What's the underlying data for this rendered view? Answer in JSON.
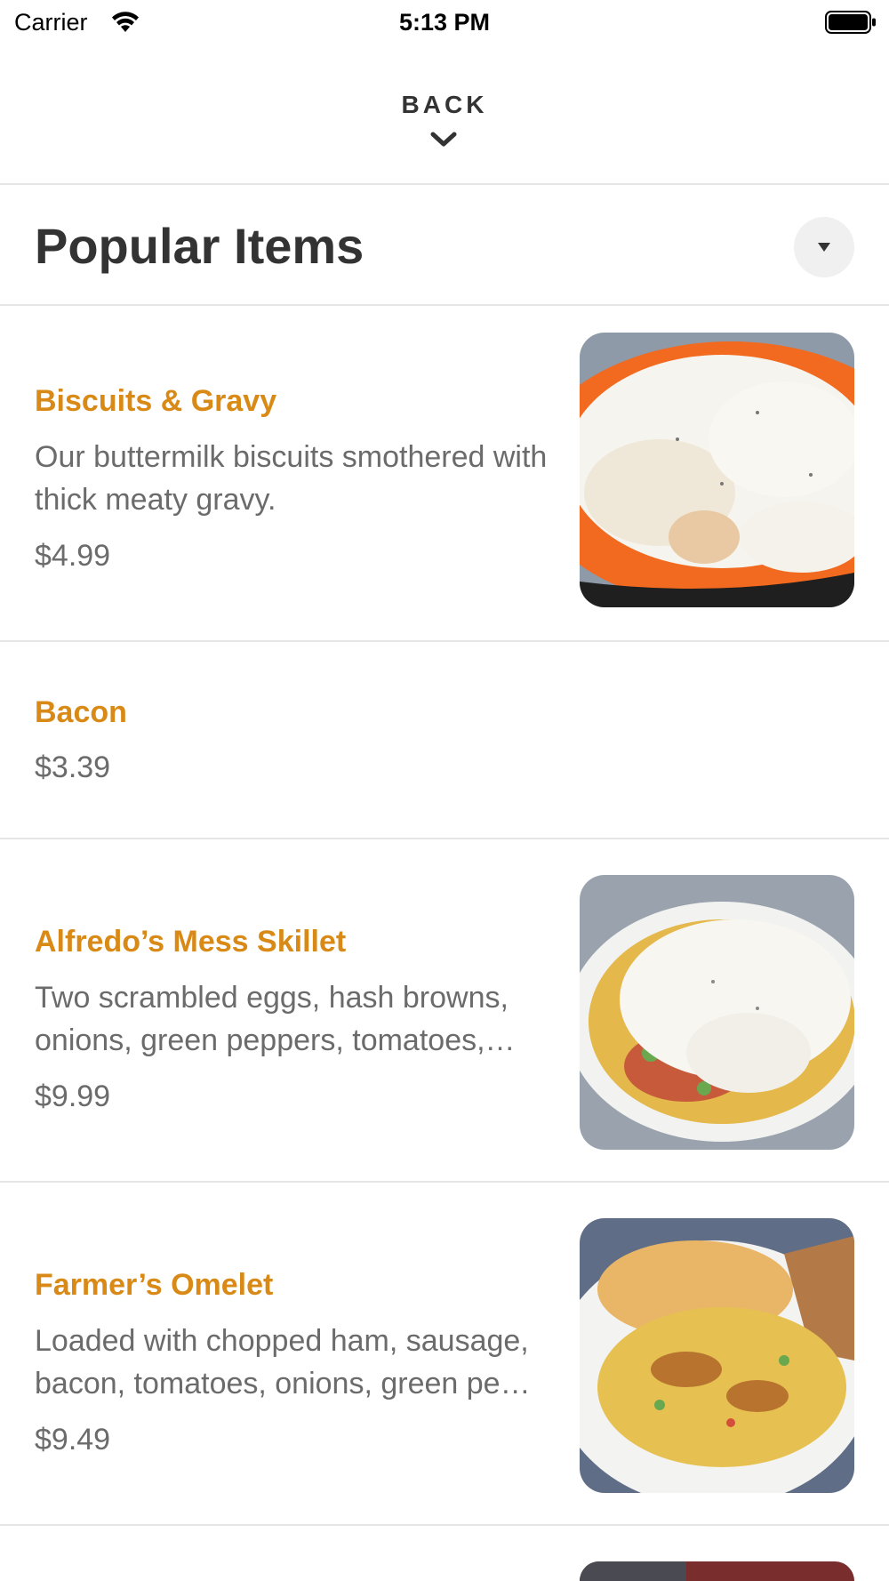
{
  "status_bar": {
    "carrier": "Carrier",
    "time": "5:13 PM",
    "wifi_icon": "wifi-icon",
    "battery_icon": "battery-icon"
  },
  "header": {
    "back_label": "BACK",
    "back_icon": "chevron-down-icon"
  },
  "section": {
    "title": "Popular Items",
    "toggle_icon": "caret-down-icon"
  },
  "colors": {
    "item_name": "#d98a16",
    "description": "#6b6b6b",
    "divider": "#e6e6e6",
    "title": "#333333"
  },
  "items": [
    {
      "name": "Biscuits & Gravy",
      "description": "Our buttermilk biscuits smothered with thick meaty gravy.",
      "price": "$4.99",
      "has_photo": true
    },
    {
      "name": "Bacon",
      "description": "",
      "price": "$3.39",
      "has_photo": false
    },
    {
      "name": "Alfredo’s Mess Skillet",
      "description": "Two scrambled eggs, hash browns, onions, green peppers, tomatoes,…",
      "price": "$9.99",
      "has_photo": true
    },
    {
      "name": "Farmer’s Omelet",
      "description": "Loaded with chopped ham, sausage, bacon, tomatoes, onions, green pe…",
      "price": "$9.49",
      "has_photo": true
    }
  ]
}
